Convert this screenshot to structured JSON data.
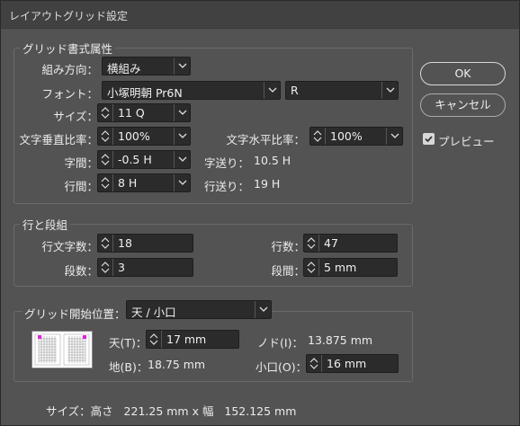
{
  "window": {
    "title": "レイアウトグリッド設定"
  },
  "grid_attributes": {
    "group_label": "グリッド書式属性",
    "direction": {
      "label": "組み方向：",
      "value": "横組み"
    },
    "font": {
      "label": "フォント：",
      "family": "小塚明朝  Pr6N",
      "style": "R"
    },
    "size": {
      "label": "サイズ：",
      "value": "11 Q"
    },
    "vertical_scale": {
      "label": "文字垂直比率：",
      "value": "100%"
    },
    "horizontal_scale": {
      "label": "文字水平比率：",
      "value": "100%"
    },
    "char_spacing": {
      "label": "字間：",
      "value": "-0.5 H"
    },
    "char_advance": {
      "label": "字送り：",
      "value": "10.5 H"
    },
    "line_spacing": {
      "label": "行間：",
      "value": "8 H"
    },
    "line_advance": {
      "label": "行送り：",
      "value": "19 H"
    }
  },
  "lines_columns": {
    "group_label": "行と段組",
    "chars_per_line": {
      "label": "行文字数：",
      "value": "18"
    },
    "lines": {
      "label": "行数：",
      "value": "47"
    },
    "columns": {
      "label": "段数：",
      "value": "3"
    },
    "gutter": {
      "label": "段間：",
      "value": "5 mm"
    }
  },
  "grid_start": {
    "label": "グリッド開始位置：",
    "value": "天 / 小口",
    "top": {
      "label": "天(T)：",
      "value": "17 mm"
    },
    "bottom": {
      "label": "地(B)：",
      "value": "18.75 mm"
    },
    "gutter_side": {
      "label": "ノド(I)：",
      "value": "13.875 mm"
    },
    "fore_edge": {
      "label": "小口(O)：",
      "value": "16 mm"
    }
  },
  "size_summary": "サイズ：高さ   221.25 mm x 幅   152.125 mm",
  "buttons": {
    "ok": "OK",
    "cancel": "キャンセル"
  },
  "preview": {
    "label": "プレビュー",
    "checked": true
  },
  "colors": {
    "background": "#535353",
    "field": "#2b2b2b",
    "accent": "#e020e0"
  }
}
